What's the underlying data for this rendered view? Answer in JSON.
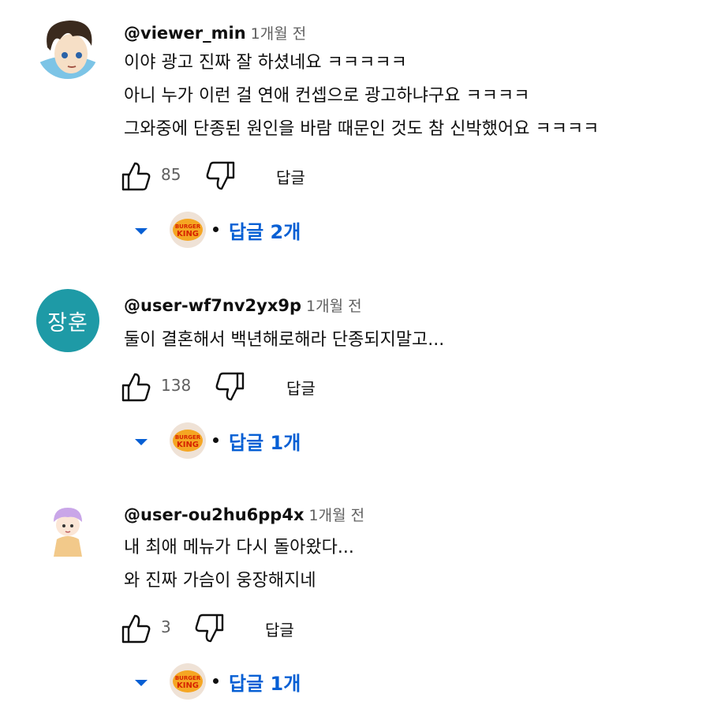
{
  "comments": [
    {
      "author": "@viewer_min",
      "time": "1개월 전",
      "lines": [
        "이야 광고 진짜 잘 하셨네요 ㅋㅋㅋㅋㅋ",
        "아니 누가 이런 걸 연애 컨셉으로 광고하냐구요 ㅋㅋㅋㅋ",
        "그와중에 단종된 원인을 바람 때문인 것도 참 신박했어요 ㅋㅋㅋㅋ"
      ],
      "likes": "85",
      "reply_label": "답글",
      "replies_label": "답글 2개"
    },
    {
      "author": "@user-wf7nv2yx9p",
      "time": "1개월 전",
      "avatar_text": "장훈",
      "lines": [
        "둘이 결혼해서 백년해로해라 단종되지말고..."
      ],
      "likes": "138",
      "reply_label": "답글",
      "replies_label": "답글 1개"
    },
    {
      "author": "@user-ou2hu6pp4x",
      "time": "1개월 전",
      "lines": [
        "내 최애 메뉴가 다시 돌아왔다...",
        "와 진짜 가슴이 웅장해지네"
      ],
      "likes": "3",
      "reply_label": "답글",
      "replies_label": "답글 1개"
    }
  ],
  "brand_logo": {
    "line1": "BURGER",
    "line2": "KING"
  },
  "colors": {
    "link": "#065fd4",
    "muted": "#606060",
    "teal_avatar": "#1e9aa6"
  },
  "icons": [
    "like-icon",
    "dislike-icon",
    "chevron-down-icon",
    "burger-king-logo"
  ]
}
